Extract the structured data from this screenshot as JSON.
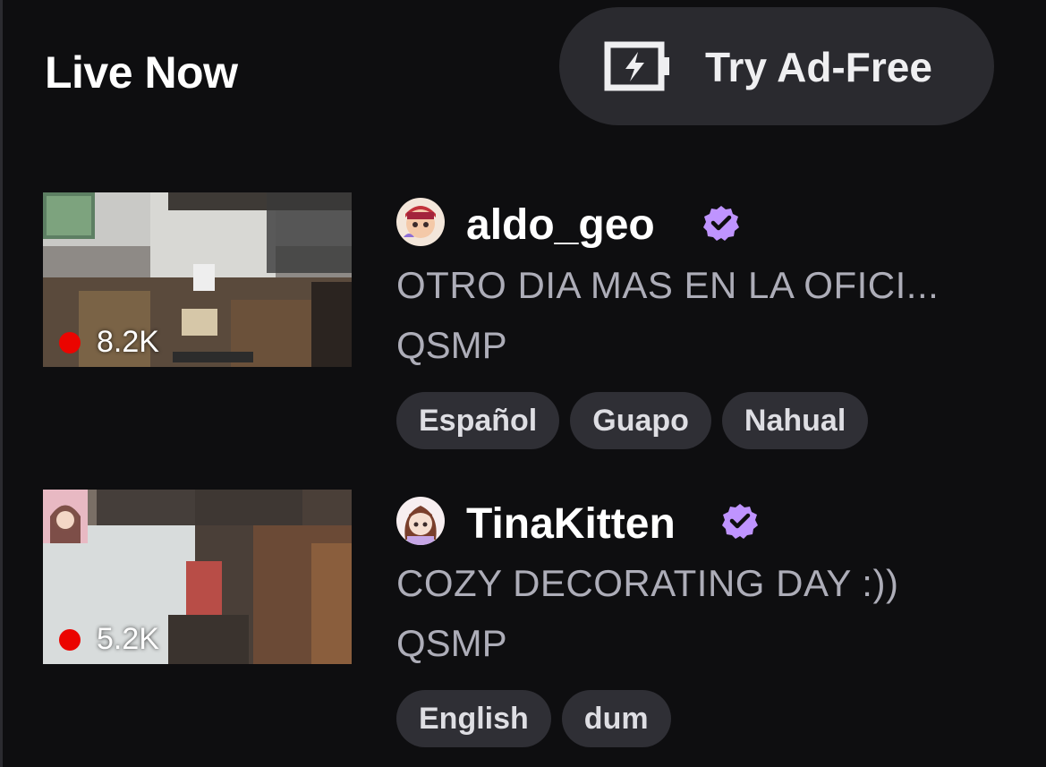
{
  "header": {
    "title": "Live Now",
    "ad_free_label": "Try Ad-Free"
  },
  "streams": [
    {
      "channel": "aldo_geo",
      "viewers": "8.2K",
      "title": "OTRO DIA MAS EN LA OFICI...",
      "category": "QSMP",
      "tags": [
        "Español",
        "Guapo",
        "Nahual"
      ],
      "verified": true
    },
    {
      "channel": "TinaKitten",
      "viewers": "5.2K",
      "title": "COZY DECORATING DAY :))",
      "category": "QSMP",
      "tags": [
        "English",
        "dum"
      ],
      "verified": true
    }
  ],
  "colors": {
    "background": "#0e0e10",
    "live_red": "#eb0400",
    "verified_purple": "#bf94ff",
    "tag_bg": "#2f2f35"
  }
}
